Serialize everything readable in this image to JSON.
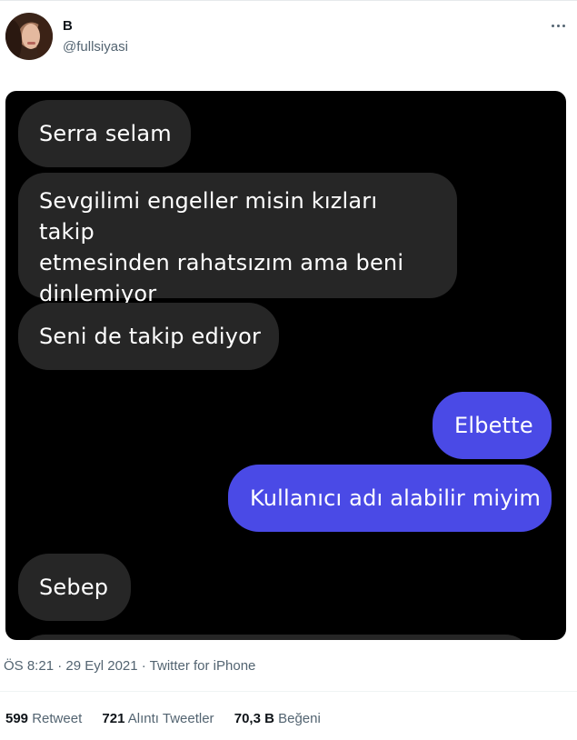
{
  "tweet": {
    "author": {
      "display_name": "B",
      "handle": "@fullsiyasi"
    },
    "more_icon": "more-horizontal-icon",
    "media": {
      "messages": [
        {
          "side": "incoming",
          "text": "Serra selam"
        },
        {
          "side": "incoming",
          "lines": [
            "Sevgilimi engeller misin kızları takip",
            "etmesinden rahatsızım ama beni",
            "dinlemiyor"
          ]
        },
        {
          "side": "incoming",
          "text": "Seni de takip ediyor"
        },
        {
          "side": "outgoing",
          "text": "Elbette"
        },
        {
          "side": "outgoing",
          "text": "Kullanıcı adı alabilir miyim"
        },
        {
          "side": "incoming",
          "text": "Sebep"
        }
      ],
      "colors": {
        "background": "#000000",
        "incoming": "#262626",
        "outgoing": "#4a4ae6"
      }
    },
    "timestamp": "ÖS 8:21 · 29 Eyl 2021",
    "separator": " · ",
    "source": "Twitter for iPhone",
    "stats": {
      "retweets": {
        "count": "599",
        "label": "Retweet"
      },
      "quotes": {
        "count": "721",
        "label": "Alıntı Tweetler"
      },
      "likes": {
        "count": "70,3 B",
        "label": "Beğeni"
      }
    }
  }
}
